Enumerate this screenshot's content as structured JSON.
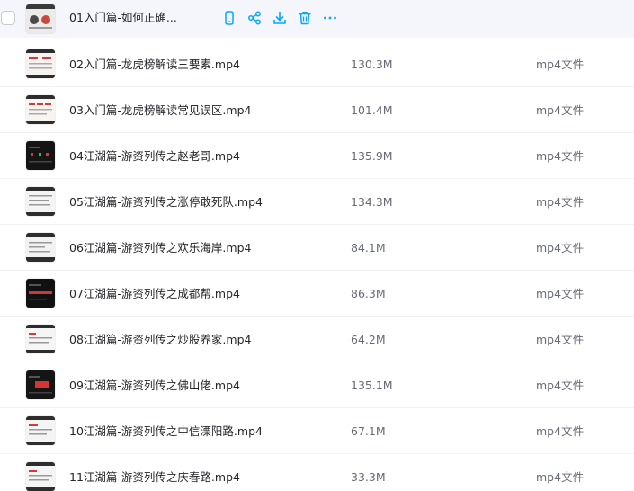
{
  "files": [
    {
      "name": "01入门篇-如何正确...",
      "size": "",
      "type": ""
    },
    {
      "name": "02入门篇-龙虎榜解读三要素.mp4",
      "size": "130.3M",
      "type": "mp4文件"
    },
    {
      "name": "03入门篇-龙虎榜解读常见误区.mp4",
      "size": "101.4M",
      "type": "mp4文件"
    },
    {
      "name": "04江湖篇-游资列传之赵老哥.mp4",
      "size": "135.9M",
      "type": "mp4文件"
    },
    {
      "name": "05江湖篇-游资列传之涨停敢死队.mp4",
      "size": "134.3M",
      "type": "mp4文件"
    },
    {
      "name": "06江湖篇-游资列传之欢乐海岸.mp4",
      "size": "84.1M",
      "type": "mp4文件"
    },
    {
      "name": "07江湖篇-游资列传之成都帮.mp4",
      "size": "86.3M",
      "type": "mp4文件"
    },
    {
      "name": "08江湖篇-游资列传之炒股养家.mp4",
      "size": "64.2M",
      "type": "mp4文件"
    },
    {
      "name": "09江湖篇-游资列传之佛山佬.mp4",
      "size": "135.1M",
      "type": "mp4文件"
    },
    {
      "name": "10江湖篇-游资列传之中信溧阳路.mp4",
      "size": "67.1M",
      "type": "mp4文件"
    },
    {
      "name": "11江湖篇-游资列传之庆春路.mp4",
      "size": "33.3M",
      "type": "mp4文件"
    }
  ],
  "hover_actions": [
    "phone-icon",
    "share-icon",
    "download-icon",
    "delete-icon",
    "more-icon"
  ],
  "colors": {
    "accent": "#06a7ff",
    "text": "#25262b",
    "muted": "#676a76",
    "hover_bg": "#f5f6fb"
  }
}
